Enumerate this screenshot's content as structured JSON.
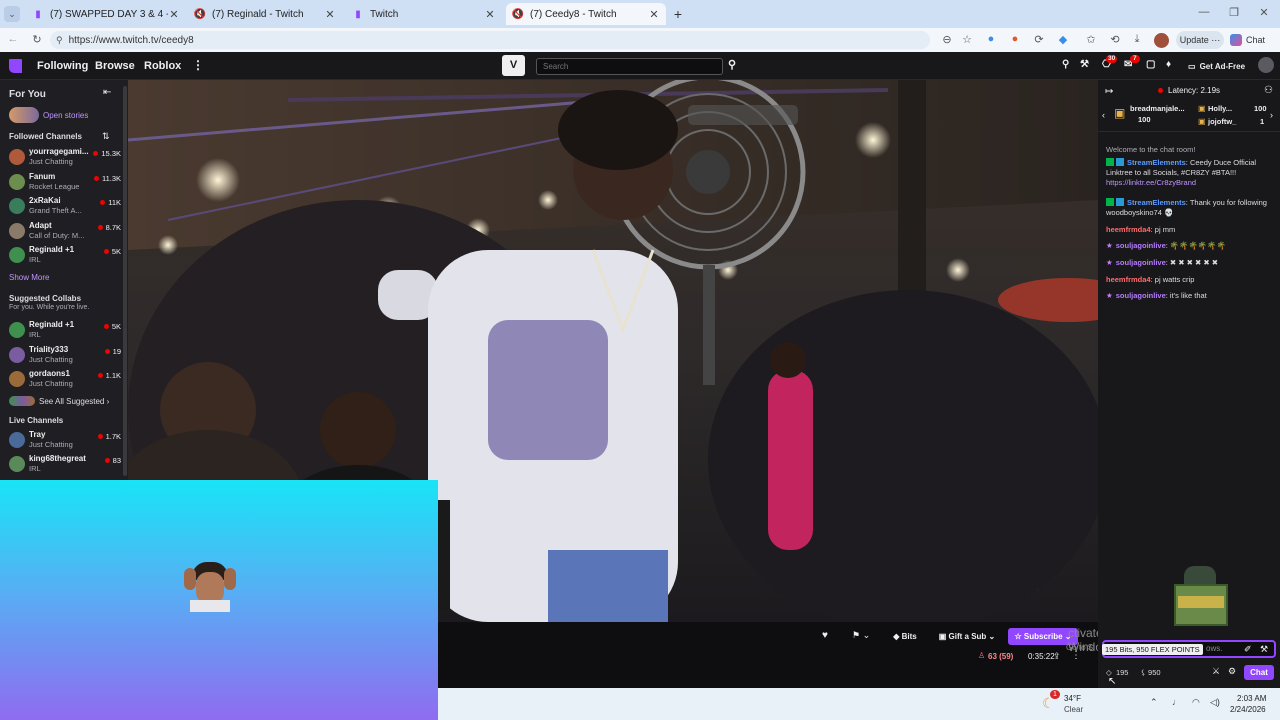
{
  "browser": {
    "tabs": [
      {
        "title": "(7) SWAPPED DAY 3 & 4 - Twitch"
      },
      {
        "title": "(7) Reginald - Twitch"
      },
      {
        "title": "Twitch"
      },
      {
        "title": "(7) Ceedy8 - Twitch"
      }
    ],
    "url": "https://www.twitch.tv/ceedy8",
    "update_label": "Update",
    "chat_label": "Chat"
  },
  "nav": {
    "following": "Following",
    "browse": "Browse",
    "roblox": "Roblox",
    "search_placeholder": "Search",
    "badge_notifications": "30",
    "badge_inbox": "7",
    "ad_free": "Get Ad-Free"
  },
  "sidebar": {
    "for_you": "For You",
    "open_stories": "Open stories",
    "followed_header": "Followed Channels",
    "followed": [
      {
        "name": "yourragegami...",
        "game": "Just Chatting",
        "viewers": "15.3K",
        "color": "#b05a3c"
      },
      {
        "name": "Fanum",
        "game": "Rocket League",
        "viewers": "11.3K",
        "color": "#6b8e4e"
      },
      {
        "name": "2xRaKai",
        "game": "Grand Theft A...",
        "viewers": "11K",
        "color": "#3a7d5c"
      },
      {
        "name": "Adapt",
        "game": "Call of Duty: M...",
        "viewers": "8.7K",
        "color": "#8a7a6a"
      },
      {
        "name": "Reginald +1",
        "game": "IRL",
        "viewers": "5K",
        "color": "#3f8f4f"
      }
    ],
    "show_more": "Show More",
    "suggested_header": "Suggested Collabs",
    "suggested_sub": "For you. While you're live.",
    "suggested": [
      {
        "name": "Reginald +1",
        "game": "IRL",
        "viewers": "5K",
        "color": "#3f8f4f"
      },
      {
        "name": "Triality333",
        "game": "Just Chatting",
        "viewers": "19",
        "color": "#7a5ca0"
      },
      {
        "name": "gordaons1",
        "game": "Just Chatting",
        "viewers": "1.1K",
        "color": "#9a6a3a"
      }
    ],
    "see_all": "See All Suggested",
    "live_header": "Live Channels",
    "live": [
      {
        "name": "Tray",
        "game": "Just Chatting",
        "viewers": "1.7K",
        "color": "#4a6a9a"
      },
      {
        "name": "king68thegreat",
        "game": "IRL",
        "viewers": "83",
        "color": "#5a8a5a"
      }
    ]
  },
  "player": {
    "bits": "Bits",
    "gift_sub": "Gift a Sub",
    "subscribe": "Subscribe",
    "viewers": "63 (59)",
    "uptime": "0:35:22"
  },
  "watermark": {
    "line1": "ctivate Windows",
    "line2": "Go to S",
    "line3": "ows."
  },
  "chat": {
    "latency": "Latency: 2.19s",
    "hype": [
      {
        "user": "breadmanjale...",
        "amount": "100"
      },
      {
        "user": "Holly...",
        "amount": "100"
      },
      {
        "user": "jojoftw_",
        "amount": "1"
      }
    ],
    "welcome": "Welcome to the chat room!",
    "messages": [
      {
        "user": "StreamElements",
        "color": "#5b9bff",
        "text": "Ceedy Duce Official Linktree to all Socials, #CR8ZY #BTA!!!",
        "link": "https://linktr.ee/Cr8zyBrand"
      },
      {
        "user": "StreamElements",
        "color": "#5b9bff",
        "text": "Thank you for following woodboyskino74 💀"
      },
      {
        "user": "heemfrmda4",
        "color": "#ff6b6b",
        "text": "pj mm"
      },
      {
        "user": "souljagoinlive",
        "color": "#b57bff",
        "text": "🌴🌴🌴🌴🌴🌴"
      },
      {
        "user": "souljagoinlive",
        "color": "#b57bff",
        "text": "✖ ✖ ✖ ✖ ✖ ✖"
      },
      {
        "user": "heemfrmda4",
        "color": "#ff6b6b",
        "text": "pj watts crip"
      },
      {
        "user": "souljagoinlive",
        "color": "#b57bff",
        "text": "it's like that"
      }
    ],
    "tooltip": "195 Bits, 950 FLEX POINTS",
    "bits_count": "195",
    "points_count": "950",
    "chat_button": "Chat"
  },
  "taskbar": {
    "weather_temp": "34°F",
    "weather_desc": "Clear",
    "weather_badge": "1",
    "time": "2:03 AM",
    "date": "2/24/2026"
  },
  "colors": {
    "accent": "#9146ff",
    "live_red": "#eb0400",
    "chat_bg": "#18181b"
  }
}
